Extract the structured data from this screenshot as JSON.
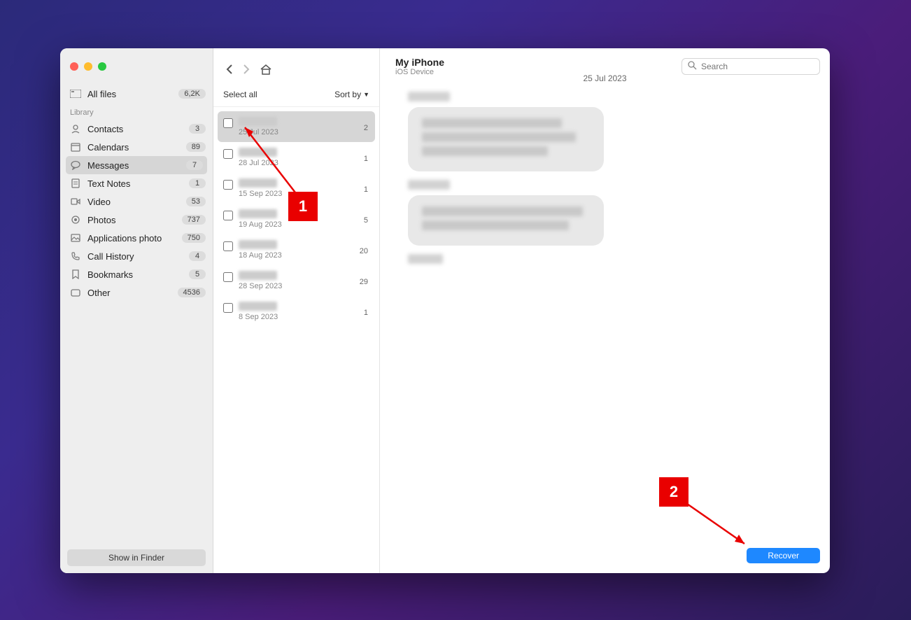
{
  "header": {
    "title": "My iPhone",
    "subtitle": "iOS Device",
    "search_placeholder": "Search"
  },
  "sidebar": {
    "all_files": {
      "label": "All files",
      "badge": "6,2K"
    },
    "section": "Library",
    "items": [
      {
        "label": "Contacts",
        "badge": "3",
        "icon": "contacts"
      },
      {
        "label": "Calendars",
        "badge": "89",
        "icon": "calendar"
      },
      {
        "label": "Messages",
        "badge": "7",
        "icon": "messages",
        "active": true
      },
      {
        "label": "Text Notes",
        "badge": "1",
        "icon": "notes"
      },
      {
        "label": "Video",
        "badge": "53",
        "icon": "video"
      },
      {
        "label": "Photos",
        "badge": "737",
        "icon": "photos"
      },
      {
        "label": "Applications photo",
        "badge": "750",
        "icon": "appphoto"
      },
      {
        "label": "Call History",
        "badge": "4",
        "icon": "call"
      },
      {
        "label": "Bookmarks",
        "badge": "5",
        "icon": "bookmark"
      },
      {
        "label": "Other",
        "badge": "4536",
        "icon": "other"
      }
    ],
    "show_in_finder": "Show in Finder"
  },
  "middle": {
    "select_all": "Select all",
    "sort_by": "Sort by",
    "conversations": [
      {
        "date": "25 Jul 2023",
        "count": "2",
        "selected": true
      },
      {
        "date": "28 Jul 2023",
        "count": "1"
      },
      {
        "date": "15 Sep 2023",
        "count": "1"
      },
      {
        "date": "19 Aug 2023",
        "count": "5"
      },
      {
        "date": "18 Aug 2023",
        "count": "20"
      },
      {
        "date": "28 Sep 2023",
        "count": "29"
      },
      {
        "date": "8 Sep 2023",
        "count": "1"
      }
    ]
  },
  "content": {
    "date_header": "25 Jul 2023"
  },
  "footer": {
    "recover": "Recover"
  },
  "annotations": {
    "one": "1",
    "two": "2"
  }
}
